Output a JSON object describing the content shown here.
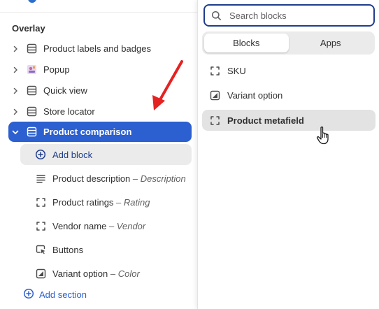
{
  "sidebar": {
    "section_title": "Overlay",
    "sections": [
      {
        "label": "Product labels and badges",
        "icon": "section-icon"
      },
      {
        "label": "Popup",
        "icon": "popup-image-icon"
      },
      {
        "label": "Quick view",
        "icon": "section-icon"
      },
      {
        "label": "Store locator",
        "icon": "section-icon"
      },
      {
        "label": "Product comparison",
        "icon": "section-icon",
        "selected": true
      }
    ],
    "blocks": [
      {
        "label": "Add block",
        "icon": "plus-circle-icon"
      },
      {
        "label": "Product description",
        "suffix": " – Description",
        "icon": "text-lines-icon"
      },
      {
        "label": "Product ratings",
        "suffix": " – Rating",
        "icon": "dashed-square-icon"
      },
      {
        "label": "Vendor name",
        "suffix": " – Vendor",
        "icon": "dashed-square-icon"
      },
      {
        "label": "Buttons",
        "icon": "button-cursor-icon"
      },
      {
        "label": "Variant option",
        "suffix": " – Color",
        "icon": "variant-icon"
      }
    ],
    "add_section_label": "Add section"
  },
  "picker": {
    "search_placeholder": "Search blocks",
    "tabs": [
      "Blocks",
      "Apps"
    ],
    "active_tab": "Blocks",
    "items": [
      {
        "label": "SKU",
        "icon": "dashed-square-icon"
      },
      {
        "label": "Variant option",
        "icon": "variant-icon"
      },
      {
        "label": "Product metafield",
        "icon": "dashed-square-icon",
        "hovered": true
      }
    ]
  },
  "colors": {
    "accent": "#2c5fcf",
    "focus_border": "#1f3d8c",
    "arrow": "#e52222"
  }
}
